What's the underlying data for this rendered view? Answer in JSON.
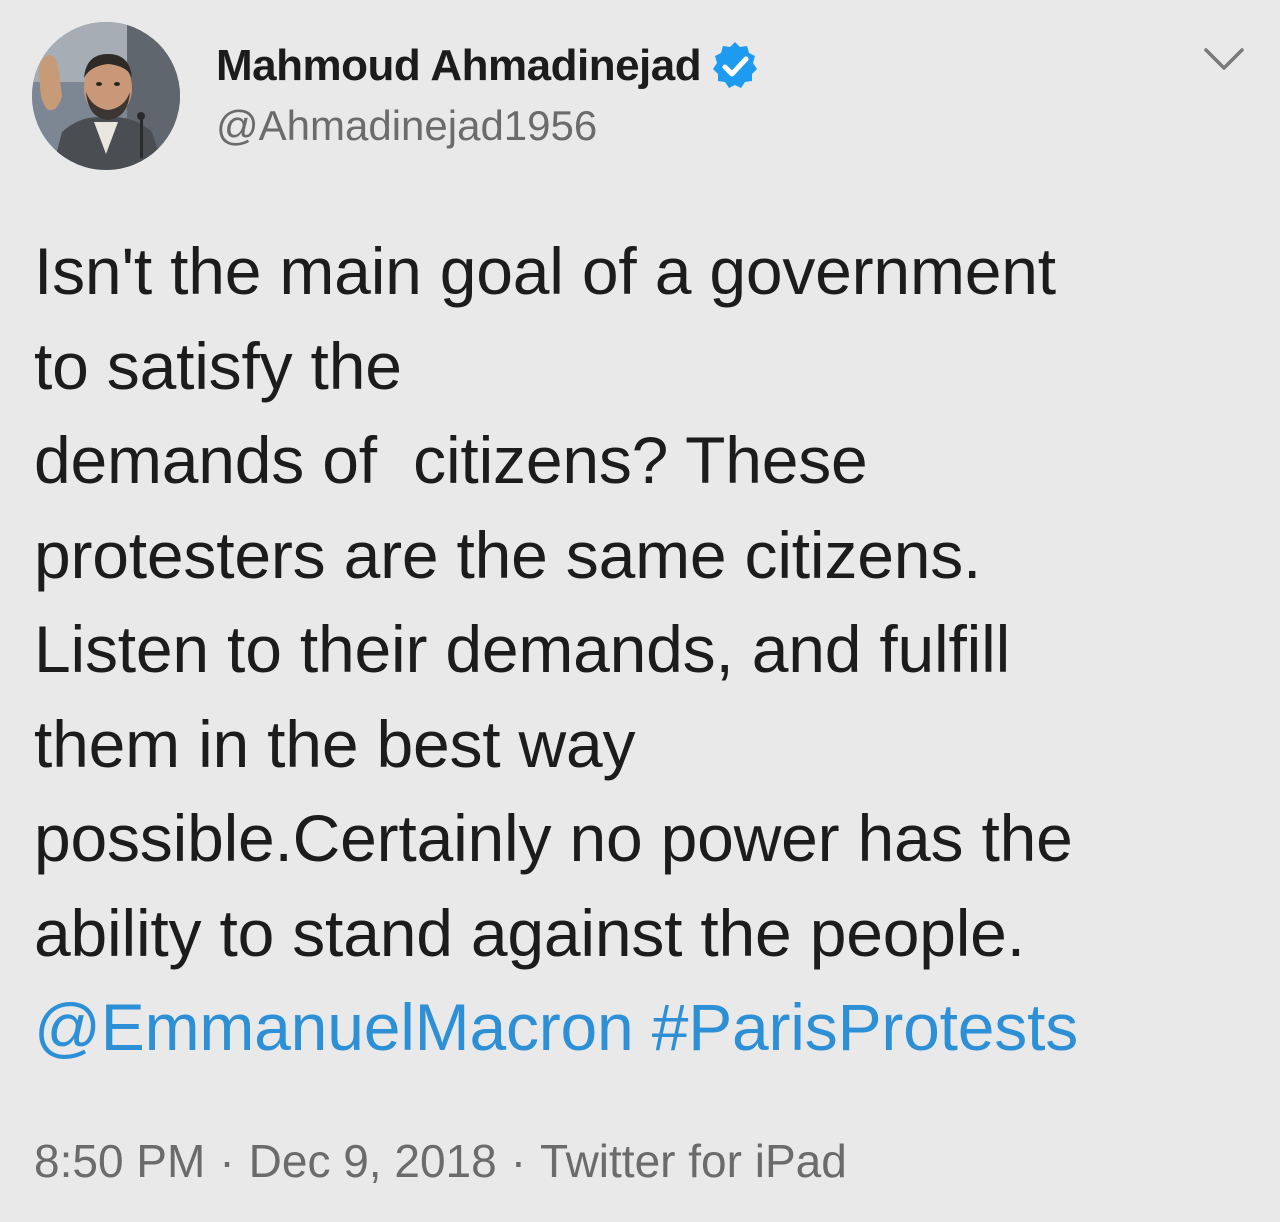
{
  "author": {
    "display_name": "Mahmoud Ahmadinejad",
    "handle": "@Ahmadinejad1956",
    "verified": true
  },
  "tweet": {
    "lines": [
      "Isn't the main goal of a government",
      "to satisfy the",
      "demands of  citizens? These",
      "protesters are the same citizens.",
      "Listen to their demands, and fulfill",
      "them in the best way",
      "possible.Certainly no power has the",
      "ability to stand against the people."
    ],
    "mention": "@EmmanuelMacron",
    "hashtag": "#ParisProtests"
  },
  "meta": {
    "time": "8:50 PM",
    "date": "Dec 9, 2018",
    "source": "Twitter for iPad",
    "separator": "·"
  },
  "icons": {
    "verified": "verified-badge-icon",
    "menu": "chevron-down-icon"
  },
  "colors": {
    "background": "#e9e9e9",
    "text": "#1c1c1c",
    "secondary_text": "#6b6b6b",
    "link": "#2d8fd5",
    "verified": "#1d9bf0"
  }
}
